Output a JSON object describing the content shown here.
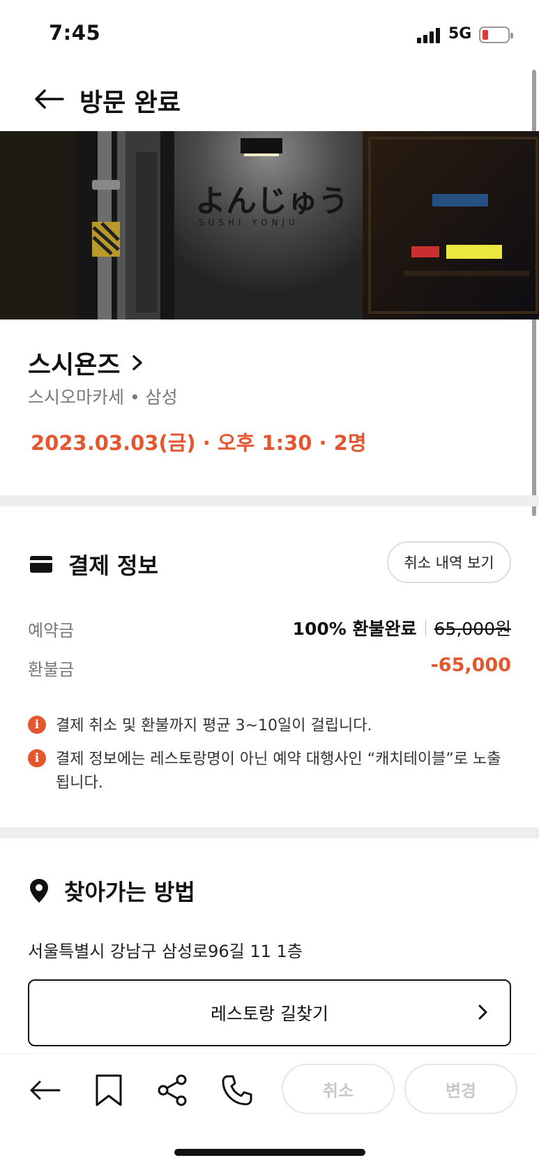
{
  "status_bar": {
    "time": "7:45",
    "network": "5G"
  },
  "header": {
    "title": "방문 완료"
  },
  "hero": {
    "sign_text": "よんじゅう",
    "sign_sub": "SUSHI YONJU"
  },
  "restaurant": {
    "name": "스시욘즈",
    "subtitle": "스시오마카세 • 삼성",
    "reservation": "2023.03.03(금) · 오후 1:30 · 2명"
  },
  "payment": {
    "title": "결제 정보",
    "history_button": "취소 내역 보기",
    "deposit_label": "예약금",
    "deposit_status": "100% 환불완료",
    "deposit_original": "65,000원",
    "refund_label": "환불금",
    "refund_amount": "-65,000",
    "notices": [
      "결제 취소 및 환불까지 평균 3~10일이 걸립니다.",
      "결제 정보에는 레스토랑명이 아닌 예약 대행사인 “캐치테이블”로 노출됩니다."
    ]
  },
  "directions": {
    "title": "찾아가는 방법",
    "address": "서울특별시 강남구 삼성로96길 11 1층",
    "route_button": "레스토랑 길찾기"
  },
  "bottom_bar": {
    "cancel": "취소",
    "change": "변경"
  },
  "colors": {
    "accent": "#e4572e",
    "divider": "#eeeeee",
    "disabled": "#c8c8c8"
  }
}
